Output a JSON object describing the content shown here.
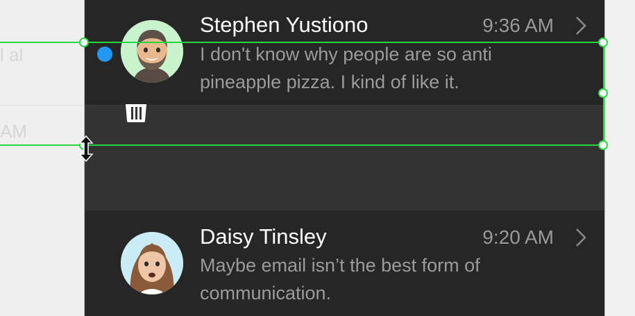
{
  "background": {
    "left_fragments": [
      "l al",
      "AM"
    ]
  },
  "messages": [
    {
      "name": "Stephen Yustiono",
      "time": "9:36 AM",
      "preview_line1": "I don't know why people are so anti",
      "preview_line2": "pineapple pizza. I kind of like it.",
      "unread": true,
      "avatar": "memoji-man-avatar"
    },
    {
      "name": "Daisy Tinsley",
      "time": "9:20 AM",
      "preview_line1": "Maybe email isn’t the best form of",
      "preview_line2": "communication.",
      "unread": false,
      "avatar": "memoji-woman-avatar"
    }
  ],
  "icons": {
    "unread": "unread-dot-icon",
    "chevron": "chevron-right-icon",
    "delete": "trash-icon",
    "cursor": "resize-vertical-cursor-icon"
  },
  "colors": {
    "unread_dot": "#2196f3",
    "selection": "#27d640",
    "row_bg": "#262626",
    "action_bg": "#333333"
  }
}
